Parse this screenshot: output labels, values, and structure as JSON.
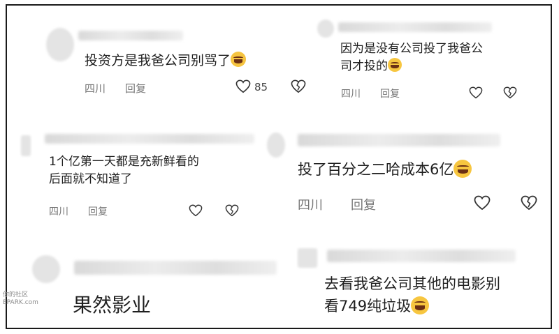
{
  "comments": [
    {
      "text": "投资方是我爸公司别骂了",
      "emoji": "crying-face",
      "location": "四川",
      "reply_label": "回复",
      "likes": "85"
    },
    {
      "text_line1": "因为是没有公司投了我爸公",
      "text_line2": "司才投的",
      "emoji": "laughing-face",
      "location": "四川",
      "reply_label": "回复"
    },
    {
      "text_line1": "1个亿第一天都是充新鲜看的",
      "text_line2": "后面就不知道了",
      "location": "四川",
      "reply_label": "回复"
    },
    {
      "text": "投了百分之二哈成本6亿",
      "emoji": "laughing-face",
      "location": "四川",
      "reply_label": "回复"
    },
    {
      "text": "果然影业"
    },
    {
      "text_line1": "去看我爸公司其他的电影别",
      "text_line2": "看749纯垃圾",
      "emoji": "laughing-face"
    }
  ],
  "watermark": {
    "line1": "你的社区",
    "line2": "EPARK.com"
  },
  "colors": {
    "emoji_yellow": "#f7c640",
    "border": "#1a1a1a",
    "meta_gray": "#777777"
  }
}
